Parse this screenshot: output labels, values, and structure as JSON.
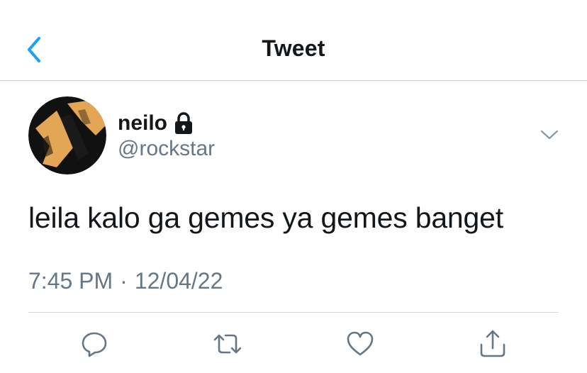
{
  "header": {
    "title": "Tweet",
    "back_icon": "chevron-left-icon",
    "accent_color": "#1da1f2"
  },
  "tweet": {
    "display_name": "neilo",
    "protected_icon": "lock-icon",
    "handle": "@rockstar",
    "text": "leila kalo ga gemes ya gemes banget",
    "time": "7:45 PM",
    "separator": "·",
    "date": "12/04/22",
    "menu_icon": "chevron-down-icon"
  },
  "actions": [
    {
      "icon": "reply-icon"
    },
    {
      "icon": "retweet-icon"
    },
    {
      "icon": "like-icon"
    },
    {
      "icon": "share-icon"
    }
  ],
  "colors": {
    "text_primary": "#14171a",
    "text_secondary": "#657786",
    "divider": "#d6dadd"
  }
}
